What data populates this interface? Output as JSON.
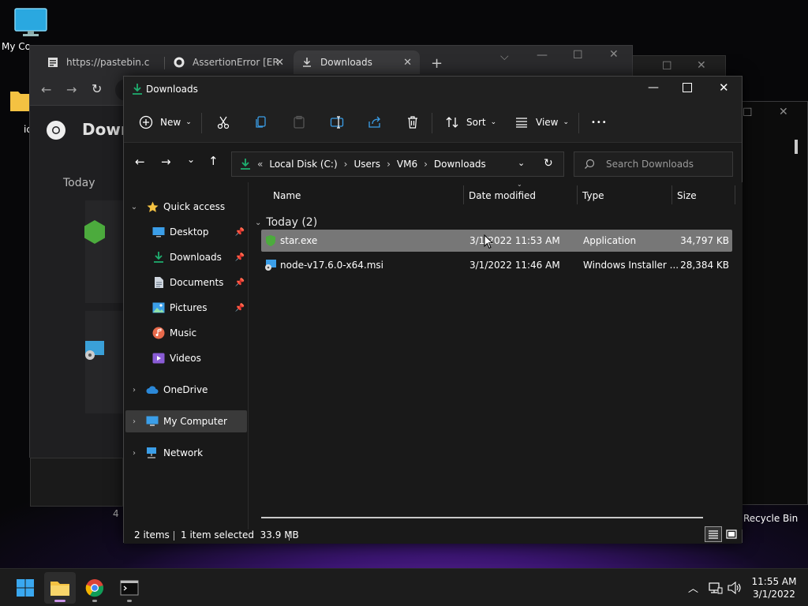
{
  "desktop": {
    "icons": [
      {
        "label": "My Co",
        "icon": "monitor-icon"
      },
      {
        "label": "ic",
        "icon": "folder-icon"
      },
      {
        "label": "Recycle Bin",
        "icon": "recycle-bin-icon"
      }
    ]
  },
  "chrome": {
    "tabs": [
      {
        "title": "https://pastebin.c",
        "icon": "pastebin-icon"
      },
      {
        "title": "AssertionError [ER",
        "icon": "github-icon"
      },
      {
        "title": "Downloads",
        "icon": "download-icon"
      }
    ],
    "page_title": "Down",
    "section": "Today",
    "status_partial": "4"
  },
  "explorer": {
    "title": "Downloads",
    "commands": {
      "new": "New",
      "sort": "Sort",
      "view": "View",
      "more": "•••"
    },
    "breadcrumb": {
      "overflow": "«",
      "items": [
        "Local Disk (C:)",
        "Users",
        "VM6",
        "Downloads"
      ],
      "separator": "›"
    },
    "search_placeholder": "Search Downloads",
    "nav": {
      "quick_access": "Quick access",
      "pinned": [
        "Desktop",
        "Downloads",
        "Documents",
        "Pictures"
      ],
      "unpinned": [
        "Music",
        "Videos"
      ],
      "onedrive": "OneDrive",
      "my_computer": "My Computer",
      "network": "Network"
    },
    "columns": [
      "Name",
      "Date modified",
      "Type",
      "Size"
    ],
    "group": "Today (2)",
    "files": [
      {
        "name": "star.exe",
        "date": "3/1/2022 11:53 AM",
        "type": "Application",
        "size": "34,797 KB",
        "selected": true
      },
      {
        "name": "node-v17.6.0-x64.msi",
        "date": "3/1/2022 11:46 AM",
        "type": "Windows Installer ...",
        "size": "28,384 KB",
        "selected": false
      }
    ],
    "status": {
      "items": "2 items",
      "selected": "1 item selected  33.9 MB"
    }
  },
  "taskbar": {
    "time": "11:55 AM",
    "date": "3/1/2022"
  },
  "colors": {
    "accent_green": "#1fae6f",
    "selection": "#777777",
    "folder_yellow": "#f4c242"
  }
}
